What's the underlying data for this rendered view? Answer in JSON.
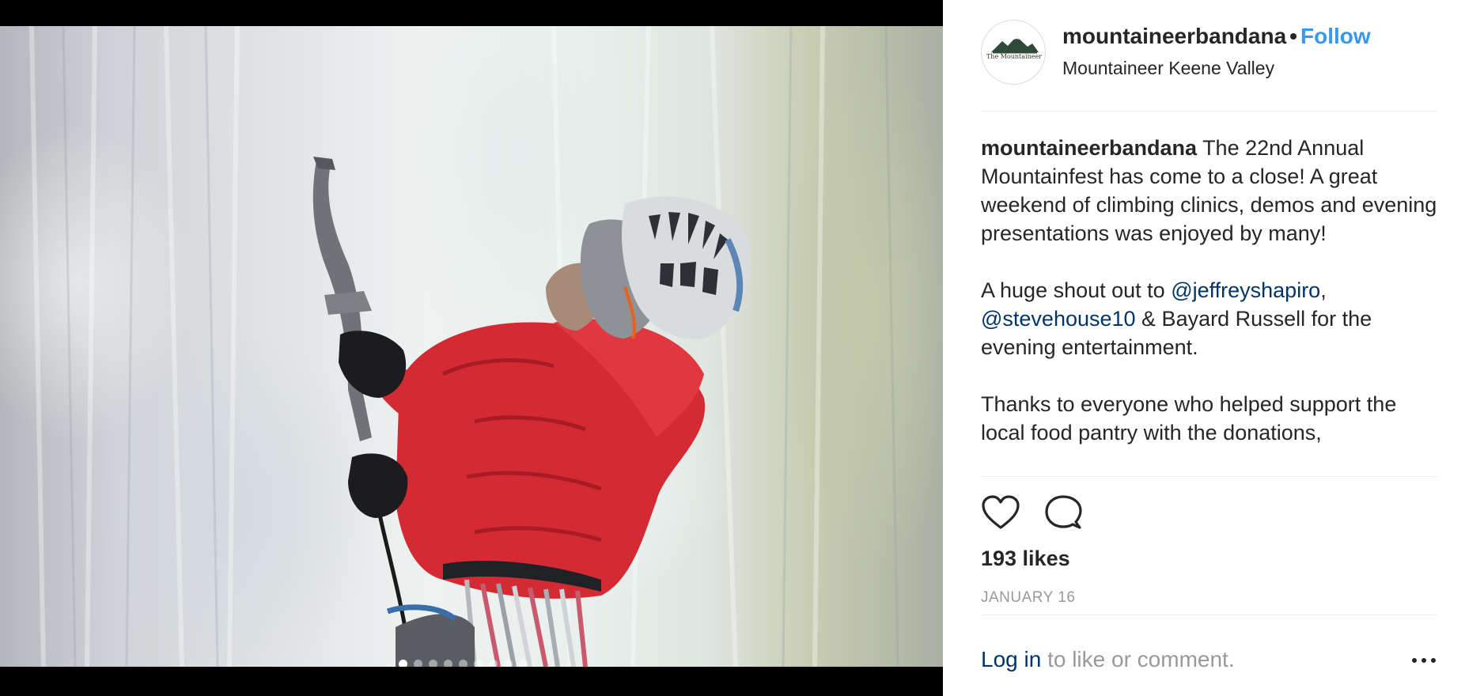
{
  "media": {
    "carousel": {
      "dot_count": 9,
      "active_index": 0
    }
  },
  "header": {
    "avatar_text": "The Mountaineer",
    "username": "mountaineerbandana",
    "separator": "•",
    "follow_label": "Follow",
    "location": "Mountaineer Keene Valley"
  },
  "caption": {
    "username": "mountaineerbandana",
    "paragraph1": "The 22nd Annual Mountainfest has come to a close! A great weekend of climbing clinics, demos and evening presentations was enjoyed by many!",
    "paragraph2_start": "A huge shout out to ",
    "mention1": "@jeffreyshapiro",
    "comma": ",",
    "mention2": "@stevehouse10",
    "paragraph2_end": " & Bayard Russell for the evening entertainment.",
    "paragraph3": "Thanks to everyone who helped support the local food pantry with the donations,"
  },
  "actions": {
    "like_icon": "heart-outline-icon",
    "comment_icon": "speech-bubble-icon",
    "likes": "193 likes",
    "date": "JANUARY 16"
  },
  "footer": {
    "login_label": "Log in",
    "prompt": " to like or comment.",
    "more_icon": "ellipsis-icon"
  },
  "colors": {
    "link_blue": "#3897f0",
    "mention_navy": "#003569",
    "muted": "#999999",
    "text": "#262626"
  }
}
